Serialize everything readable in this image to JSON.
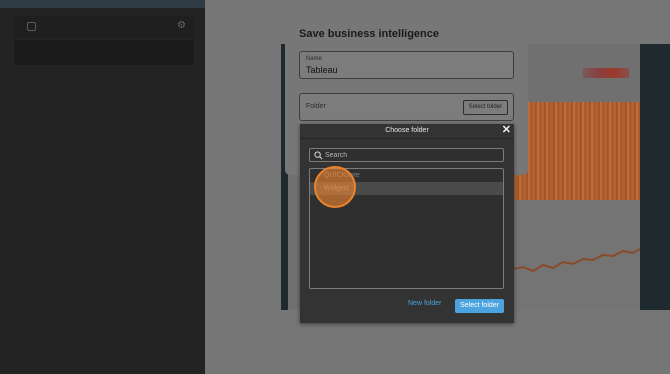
{
  "save_dialog": {
    "title": "Save business intelligence",
    "name_label": "Name",
    "name_value": "Tableau",
    "folder_label": "Folder",
    "select_folder_label": "Select folder"
  },
  "choose_folder": {
    "title": "Choose folder",
    "close_glyph": "✕",
    "search_placeholder": "Search",
    "folders": [
      {
        "label": "QUICKnote",
        "selected": false
      },
      {
        "label": "Widgets",
        "selected": true
      }
    ],
    "new_folder_label": "New folder",
    "select_folder_label": "Select folder"
  },
  "icons": {
    "search": "search-icon",
    "close": "close-icon",
    "gear": "gear-icon"
  },
  "colors": {
    "accent": "#4aa3df",
    "highlight": "#e8832f",
    "overlay": "#767676",
    "dialog": "#333333"
  }
}
